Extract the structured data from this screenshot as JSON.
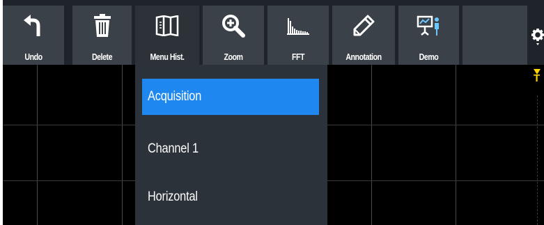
{
  "toolbar": {
    "buttons": [
      {
        "label": "Undo",
        "icon": "undo-arrow-icon"
      },
      {
        "label": "Delete",
        "icon": "trash-icon"
      },
      {
        "label": "Menu Hist.",
        "icon": "menu-history-icon"
      },
      {
        "label": "Zoom",
        "icon": "magnifier-plus-icon"
      },
      {
        "label": "FFT",
        "icon": "fft-spectrum-icon"
      },
      {
        "label": "Annotation",
        "icon": "pencil-icon"
      },
      {
        "label": "Demo",
        "icon": "demo-presenter-icon"
      }
    ],
    "settings_icon": "gear-icon"
  },
  "menu": {
    "items": [
      {
        "label": "Acquisition",
        "selected": true
      },
      {
        "label": "Channel 1",
        "selected": false
      },
      {
        "label": "Horizontal",
        "selected": false
      }
    ],
    "selected_color": "#1e88f0"
  },
  "trigger_marker": {
    "label": "T",
    "color": "#ffd400"
  },
  "colors": {
    "toolbar_bg": "#1f242a",
    "button_bg": "#3b4148",
    "menu_bg": "#2b323a",
    "screen_bg": "#000000"
  }
}
